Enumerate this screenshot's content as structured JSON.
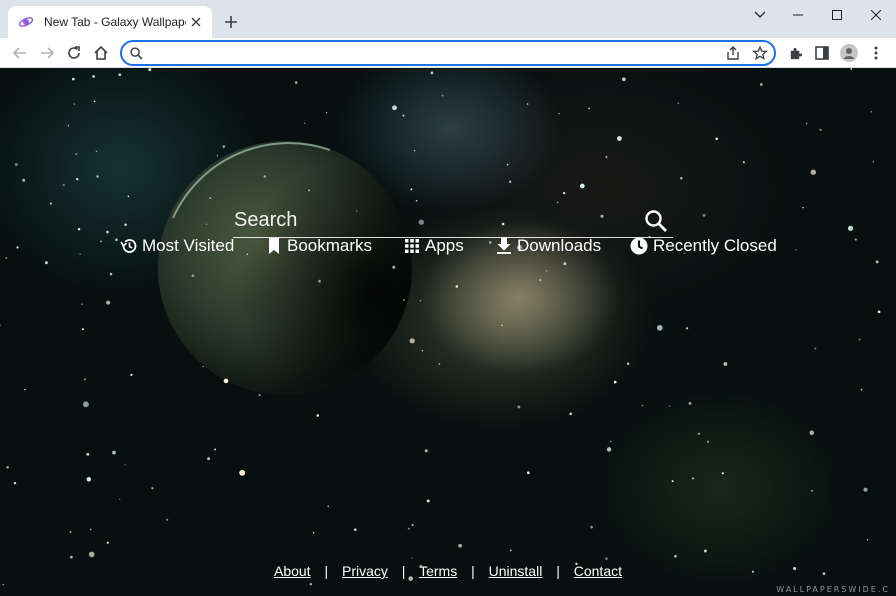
{
  "tab": {
    "title": "New Tab - Galaxy Wallpaper",
    "close_icon": "close-icon"
  },
  "toolbar": {
    "back_icon": "back-arrow-icon",
    "forward_icon": "forward-arrow-icon",
    "reload_icon": "reload-icon",
    "home_icon": "home-icon",
    "omnibox_value": ""
  },
  "page": {
    "search_placeholder": "Search",
    "quicklinks": [
      {
        "label": "Most Visited",
        "icon": "history-icon"
      },
      {
        "label": "Bookmarks",
        "icon": "bookmark-icon"
      },
      {
        "label": "Apps",
        "icon": "apps-grid-icon"
      },
      {
        "label": "Downloads",
        "icon": "download-icon"
      },
      {
        "label": "Recently Closed",
        "icon": "clock-icon"
      }
    ],
    "footer": {
      "links": [
        "About",
        "Privacy",
        "Terms",
        "Uninstall",
        "Contact"
      ],
      "separator": "|"
    },
    "watermark": "WALLPAPERSWIDE.C"
  },
  "colors": {
    "accent": "#1a73e8",
    "tabstrip": "#dee3ea"
  }
}
